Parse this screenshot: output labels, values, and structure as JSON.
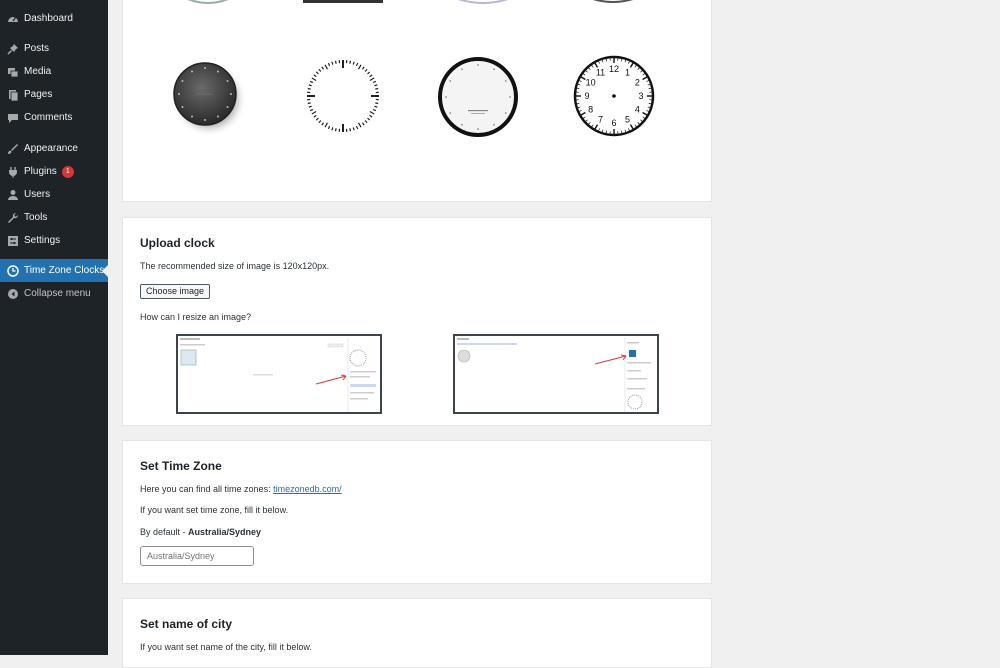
{
  "sidebar": {
    "items": [
      {
        "label": "Dashboard",
        "icon": "dashboard-icon"
      },
      {
        "label": "Posts",
        "icon": "pin-icon"
      },
      {
        "label": "Media",
        "icon": "media-icon"
      },
      {
        "label": "Pages",
        "icon": "pages-icon"
      },
      {
        "label": "Comments",
        "icon": "comments-icon"
      },
      {
        "label": "Appearance",
        "icon": "brush-icon"
      },
      {
        "label": "Plugins",
        "icon": "plugin-icon",
        "badge": "1"
      },
      {
        "label": "Users",
        "icon": "users-icon"
      },
      {
        "label": "Tools",
        "icon": "wrench-icon"
      },
      {
        "label": "Settings",
        "icon": "settings-icon"
      },
      {
        "label": "Time Zone Clocks",
        "icon": "clock-icon",
        "active": true
      },
      {
        "label": "Collapse menu",
        "icon": "collapse-icon"
      }
    ],
    "accent": "#2271b1",
    "badge_color": "#d63638"
  },
  "clocks_panel": {
    "clock_numbers": [
      "12",
      "1",
      "2",
      "3",
      "4",
      "5",
      "6",
      "7",
      "8",
      "9",
      "10",
      "11"
    ]
  },
  "upload_clock": {
    "title": "Upload clock",
    "size_note": "The recommended size of image is 120x120px.",
    "button_label": "Choose image",
    "resize_question": "How can I resize an image?"
  },
  "time_zone": {
    "title": "Set Time Zone",
    "find_text": "Here you can find all time zones:",
    "link_text": "timezonedb.com/",
    "fill_text": "If you want set time zone, fill it below.",
    "default_prefix": "By default - ",
    "default_value": "Australia/Sydney",
    "input_placeholder": "Australia/Sydney"
  },
  "city": {
    "title": "Set name of city",
    "fill_text": "If you want set name of the city, fill it below."
  }
}
